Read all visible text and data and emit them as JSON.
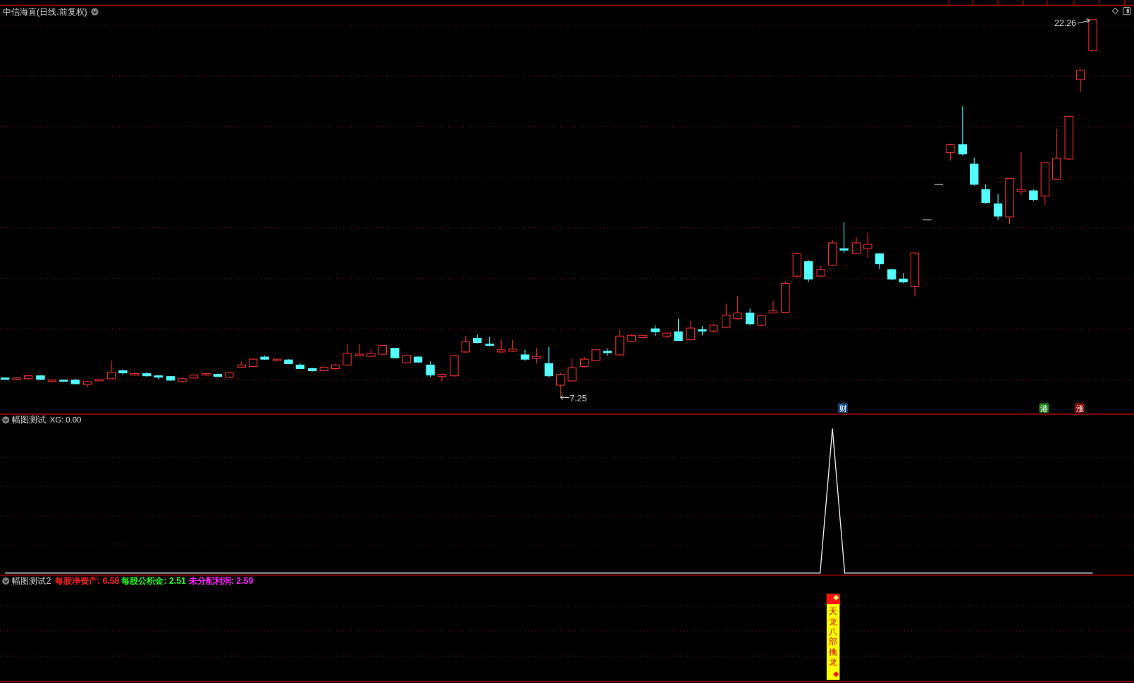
{
  "main_chart": {
    "title": "中信海直(日线.前复权)",
    "high_label": "22.26",
    "low_label": "7.25",
    "event_tags": [
      {
        "text": "财",
        "color": "#1b4f8c"
      },
      {
        "text": "港",
        "color": "#1a8a1a"
      },
      {
        "text": "涨",
        "color": "#8b0a0a"
      }
    ]
  },
  "panel_2": {
    "title": "幅图测试",
    "readings": [
      {
        "label": "XG: 0.00",
        "color": "#e0e0e0"
      }
    ]
  },
  "panel_3": {
    "title": "幅图测试2",
    "readings": [
      {
        "label": "每股净资产: 6.58",
        "color": "#ff2020"
      },
      {
        "label": "每股公积金: 2.51",
        "color": "#20ff20"
      },
      {
        "label": "未分配利润: 2.59",
        "color": "#ff20ff"
      }
    ],
    "signal_text": "天龙八部擒龙"
  }
}
